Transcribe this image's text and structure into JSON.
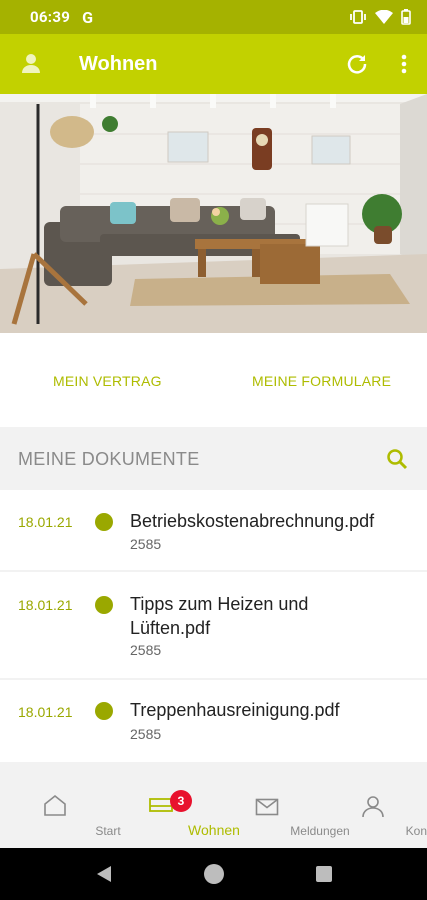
{
  "status": {
    "time": "06:39",
    "g_icon": "google-g"
  },
  "app_bar": {
    "title": "Wohnen"
  },
  "links": {
    "contract": "MEIN VERTRAG",
    "forms": "MEINE FORMULARE"
  },
  "documents": {
    "heading": "MEINE DOKUMENTE",
    "items": [
      {
        "date": "18.01.21",
        "name": "Betriebskostenabrechnung.pdf",
        "size": "2585"
      },
      {
        "date": "18.01.21",
        "name": "Tipps zum Heizen und Lüften.pdf",
        "size": "2585"
      },
      {
        "date": "18.01.21",
        "name": "Treppenhausreinigung.pdf",
        "size": "2585"
      }
    ]
  },
  "nav": {
    "items": [
      {
        "label": "Start",
        "icon": "home-icon"
      },
      {
        "label": "Wohnen",
        "icon": "sofa-icon",
        "badge": "3"
      },
      {
        "label": "Meldungen",
        "icon": "mail-icon"
      },
      {
        "label": "Kontakt",
        "icon": "person-icon"
      }
    ]
  },
  "colors": {
    "accent": "#c2d100",
    "status_bar": "#a5b200",
    "dot": "#9aa800",
    "badge": "#e8112d"
  }
}
